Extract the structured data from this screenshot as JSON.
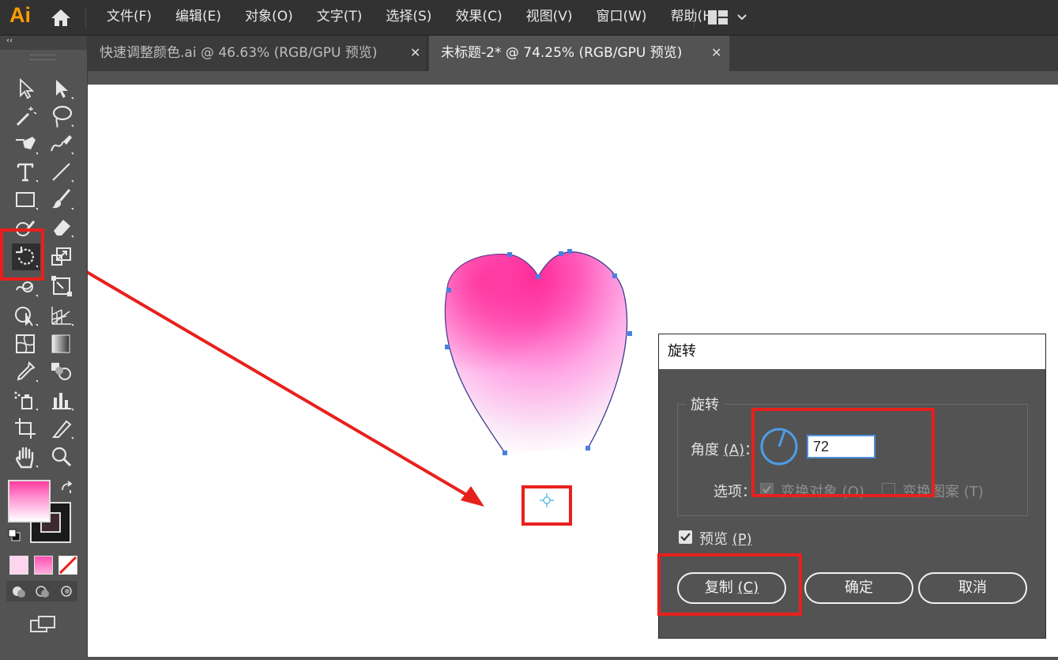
{
  "app": {
    "logo": "Ai"
  },
  "menu": [
    "文件(F)",
    "编辑(E)",
    "对象(O)",
    "文字(T)",
    "选择(S)",
    "效果(C)",
    "视图(V)",
    "窗口(W)",
    "帮助(H)"
  ],
  "toolbar": {
    "collapse": "‹‹"
  },
  "tabs": [
    {
      "label": "快速调整颜色.ai @ 46.63% (RGB/GPU 预览)",
      "close": "✕",
      "active": false
    },
    {
      "label": "未标题-2* @ 74.25% (RGB/GPU 预览)",
      "close": "✕",
      "active": true
    }
  ],
  "dialog": {
    "title": "旋转",
    "group_label": "旋转",
    "angle_label": "角度",
    "angle_key": "(A)",
    "angle_value": "72",
    "options_label": "选项：",
    "transform_objects": "变换对象 (O)",
    "transform_patterns": "变换图案 (T)",
    "preview_label": "预览",
    "preview_key": "(P)",
    "copy_button": "复制",
    "copy_key": "(C)",
    "ok_button": "确定",
    "cancel_button": "取消"
  },
  "colors": {
    "accent": "#e8201c",
    "fill_gradient_top": "#ff3da0",
    "fill_gradient_bottom": "#ffffff",
    "selection": "#4a7fe0"
  },
  "icons": [
    "selection-icon",
    "direct-selection-icon",
    "magic-wand-icon",
    "lasso-icon",
    "pen-icon",
    "curvature-icon",
    "type-icon",
    "line-segment-icon",
    "rectangle-icon",
    "paintbrush-icon",
    "shaper-icon",
    "eraser-icon",
    "rotate-icon",
    "scale-icon",
    "warp-icon",
    "free-transform-icon",
    "shape-builder-icon",
    "perspective-grid-icon",
    "mesh-icon",
    "gradient-icon",
    "eyedropper-icon",
    "blend-icon",
    "symbol-sprayer-icon",
    "column-graph-icon",
    "artboard-icon",
    "slice-icon",
    "hand-icon",
    "zoom-icon"
  ]
}
